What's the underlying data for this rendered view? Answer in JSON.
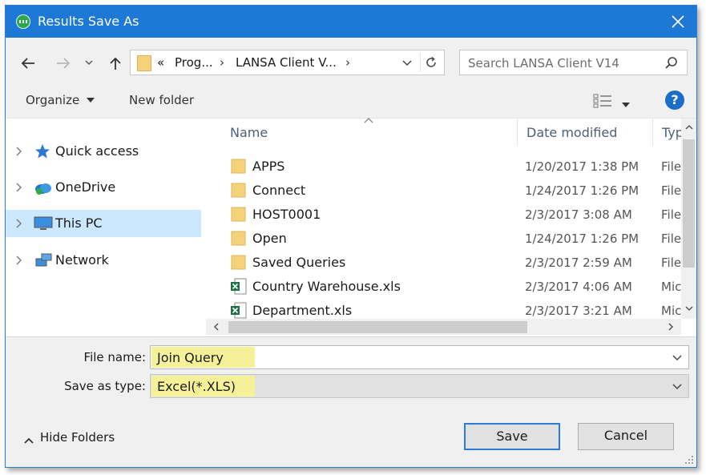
{
  "window": {
    "title": "Results Save As",
    "accent_color": "#1d78d6",
    "highlight_color": "#f4f199"
  },
  "address_bar": {
    "overflow": "«",
    "crumbs": [
      "Prog...",
      "LANSA Client V..."
    ]
  },
  "search": {
    "placeholder": "Search LANSA Client V14"
  },
  "toolbar": {
    "organize_label": "Organize",
    "new_folder_label": "New folder",
    "help_label": "?"
  },
  "nav_pane": {
    "items": [
      {
        "label": "Quick access",
        "icon": "star-icon",
        "selected": false
      },
      {
        "label": "OneDrive",
        "icon": "cloud-icon",
        "selected": false
      },
      {
        "label": "This PC",
        "icon": "monitor-icon",
        "selected": true
      },
      {
        "label": "Network",
        "icon": "network-icon",
        "selected": false
      }
    ]
  },
  "file_list": {
    "columns": {
      "name": "Name",
      "date": "Date modified",
      "type": "Typ"
    },
    "rows": [
      {
        "name": "APPS",
        "date": "1/20/2017 1:38 PM",
        "type": "File",
        "icon": "folder-icon"
      },
      {
        "name": "Connect",
        "date": "1/24/2017 1:26 PM",
        "type": "File",
        "icon": "folder-icon"
      },
      {
        "name": "HOST0001",
        "date": "2/3/2017 3:08 AM",
        "type": "File",
        "icon": "folder-icon"
      },
      {
        "name": "Open",
        "date": "1/24/2017 1:26 PM",
        "type": "File",
        "icon": "folder-icon"
      },
      {
        "name": "Saved Queries",
        "date": "2/3/2017 2:59 AM",
        "type": "File",
        "icon": "folder-icon"
      },
      {
        "name": "Country Warehouse.xls",
        "date": "2/3/2017 4:06 AM",
        "type": "Mic",
        "icon": "excel-file-icon"
      },
      {
        "name": "Department.xls",
        "date": "2/3/2017 3:21 AM",
        "type": "Mic",
        "icon": "excel-file-icon"
      }
    ]
  },
  "form": {
    "file_name_label": "File name:",
    "file_name_value": "Join Query",
    "save_type_label": "Save as type:",
    "save_type_value": "Excel(*.XLS)"
  },
  "footer": {
    "hide_folders_label": "Hide Folders",
    "save_label": "Save",
    "cancel_label": "Cancel"
  }
}
